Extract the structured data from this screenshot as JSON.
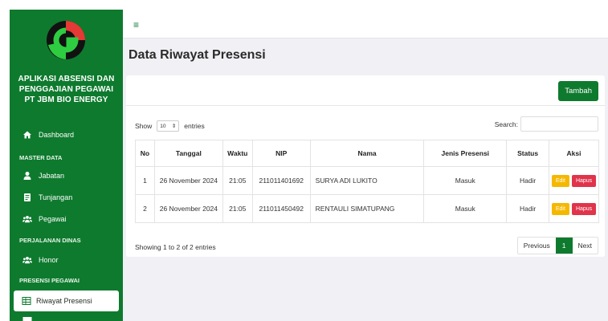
{
  "app": {
    "name_lines": [
      "APLIKASI ABSENSI DAN",
      "PENGGAJIAN PEGAWAI",
      "PT JBM BIO ENERGY"
    ]
  },
  "sidebar": {
    "items": [
      {
        "label": "Dashboard",
        "icon": "home-icon"
      },
      {
        "section": "MASTER DATA"
      },
      {
        "label": "Jabatan",
        "icon": "user-icon"
      },
      {
        "label": "Tunjangan",
        "icon": "document-icon"
      },
      {
        "label": "Pegawai",
        "icon": "users-icon"
      },
      {
        "section": "PERJALANAN DINAS"
      },
      {
        "label": "Honor",
        "icon": "users-icon"
      },
      {
        "section": "PRESENSI PEGAWAI"
      },
      {
        "label": "Riwayat Presensi",
        "icon": "table-icon",
        "active": true
      }
    ]
  },
  "page": {
    "title": "Data Riwayat Presensi",
    "add_button": "Tambah"
  },
  "table_controls": {
    "show_label": "Show",
    "entries_value": "10",
    "entries_label": "entries",
    "search_label": "Search:",
    "search_value": ""
  },
  "table": {
    "headers": [
      "No",
      "Tanggal",
      "Waktu",
      "NIP",
      "Nama",
      "Jenis Presensi",
      "Status",
      "Aksi"
    ],
    "rows": [
      {
        "no": "1",
        "tanggal": "26 November 2024",
        "waktu": "21:05",
        "nip": "211011401692",
        "nama": "SURYA ADI LUKITO",
        "jenis": "Masuk",
        "status": "Hadir"
      },
      {
        "no": "2",
        "tanggal": "26 November 2024",
        "waktu": "21:05",
        "nip": "211011450492",
        "nama": "RENTAULI SIMATUPANG",
        "jenis": "Masuk",
        "status": "Hadir"
      }
    ],
    "edit_label": "Edit",
    "delete_label": "Hapus"
  },
  "footer": {
    "info": "Showing 1 to 2 of 2 entries",
    "prev": "Previous",
    "page": "1",
    "next": "Next"
  },
  "colors": {
    "sidebar": "#0e7a2e",
    "edit": "#f5b800",
    "delete": "#e0344b"
  }
}
